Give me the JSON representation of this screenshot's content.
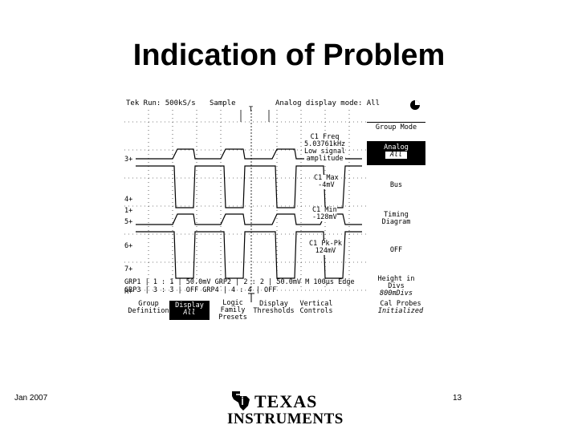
{
  "slide": {
    "title": "Indication of Problem",
    "date": "Jan 2007",
    "page_number": "13",
    "logo_word1": "TEXAS",
    "logo_word2": "INSTRUMENTS"
  },
  "scope": {
    "header_brand_rate": "Tek Run: 500kS/s",
    "header_mode": "Sample",
    "header_display_mode": "Analog display mode: All",
    "trigger_marker": "T",
    "channel_markers": [
      "3+",
      "4+",
      "1+",
      "5+",
      "6+",
      "7+",
      "R+"
    ],
    "readouts": [
      {
        "lines": [
          "C1 Freq",
          "5.03761kHz",
          "Low signal",
          "amplitude"
        ]
      },
      {
        "lines": [
          "C1 Max",
          "-4mV"
        ]
      },
      {
        "lines": [
          "C1 Min",
          "-128mV"
        ]
      },
      {
        "lines": [
          "C1 Pk-Pk",
          "124mV"
        ]
      }
    ],
    "side_menu": {
      "group_mode": "Group Mode",
      "analog": "Analog",
      "analog_sub": "All",
      "bus": "Bus",
      "timing_line1": "Timing",
      "timing_line2": "Diagram",
      "off": "OFF",
      "height_line1": "Height in",
      "height_line2": "Divs",
      "height_value": "800mDivs"
    },
    "group_table": {
      "row1": "GRP1 | 1 : 1 | 50.0mV  GRP2 | 2 : 2 | 50.0mV  M  100µs  Edge",
      "row2": "GRP3 | 3 : 3 | OFF     GRP4 | 4 : 4 | OFF"
    },
    "bottom_menu": [
      {
        "line1": "Group",
        "line2": "Definition"
      },
      {
        "line1": "Display",
        "line2": "All"
      },
      {
        "line1": "Logic",
        "line2": "Family",
        "line3": "Presets"
      },
      {
        "line1": "Display",
        "line2": "Thresholds"
      },
      {
        "line1": "Vertical",
        "line2": "Controls"
      },
      {
        "line1": "Cal Probes",
        "line2": "Initialized"
      }
    ]
  }
}
